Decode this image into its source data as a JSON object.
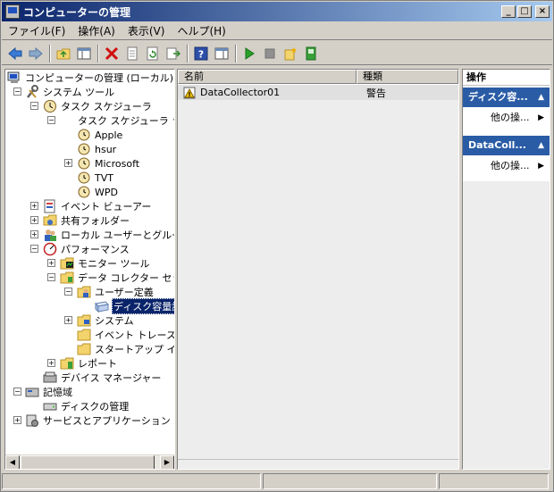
{
  "window": {
    "title": "コンピューターの管理",
    "min": "_",
    "max": "□",
    "close": "×"
  },
  "menu": [
    "ファイル(F)",
    "操作(A)",
    "表示(V)",
    "ヘルプ(H)"
  ],
  "tree": {
    "items": [
      {
        "label": "コンピューターの管理 (ローカル)"
      },
      {
        "label": "システム ツール"
      },
      {
        "label": "タスク スケジューラ"
      },
      {
        "label": "タスク スケジューラ ライブ"
      },
      {
        "label": "Apple"
      },
      {
        "label": "hsur"
      },
      {
        "label": "Microsoft"
      },
      {
        "label": "TVT"
      },
      {
        "label": "WPD"
      },
      {
        "label": "イベント ビューアー"
      },
      {
        "label": "共有フォルダー"
      },
      {
        "label": "ローカル ユーザーとグループ"
      },
      {
        "label": "パフォーマンス"
      },
      {
        "label": "モニター ツール"
      },
      {
        "label": "データ コレクター セット"
      },
      {
        "label": "ユーザー定義"
      },
      {
        "label": "ディスク容量診断"
      },
      {
        "label": "システム"
      },
      {
        "label": "イベント トレース セ"
      },
      {
        "label": "スタートアップ イベ"
      },
      {
        "label": "レポート"
      },
      {
        "label": "デバイス マネージャー"
      },
      {
        "label": "記憶域"
      },
      {
        "label": "ディスクの管理"
      },
      {
        "label": "サービスとアプリケーション"
      }
    ]
  },
  "list": {
    "col_name": "名前",
    "col_type": "種類",
    "rows": [
      {
        "name": "DataCollector01",
        "type": "警告"
      }
    ]
  },
  "actions": {
    "header": "操作",
    "groups": [
      {
        "title": "ディスク容...",
        "item": "他の操..."
      },
      {
        "title": "DataColl...",
        "item": "他の操..."
      }
    ]
  },
  "colors": {
    "title_start": "#0a246a",
    "title_end": "#a6caf0",
    "action_group": "#2a5ca6",
    "selection": "#0a246a"
  }
}
